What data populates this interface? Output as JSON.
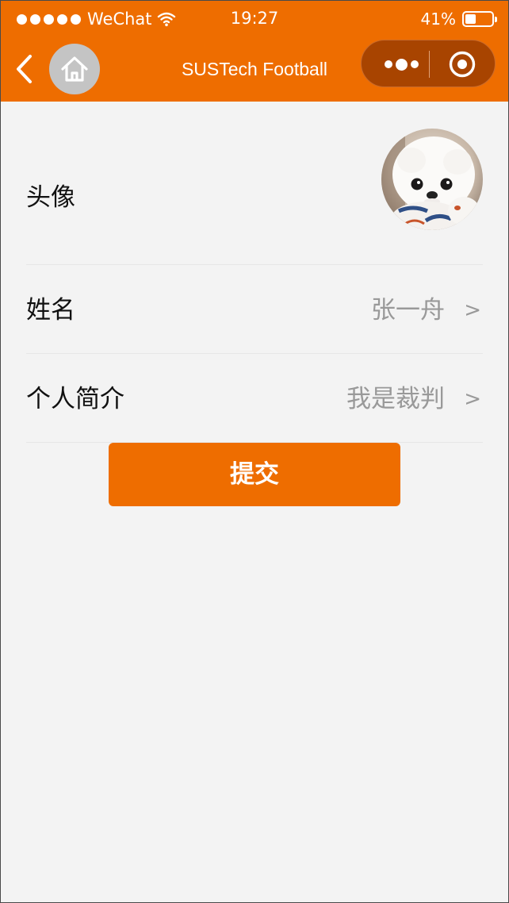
{
  "status_bar": {
    "carrier": "WeChat",
    "time": "19:27",
    "battery_text": "41%",
    "battery_level": 0.41
  },
  "nav": {
    "title": "SUSTech Football"
  },
  "form": {
    "avatar_label": "头像",
    "name_label": "姓名",
    "name_value": "张一舟",
    "intro_label": "个人简介",
    "intro_value": "我是裁判",
    "arrow": ">"
  },
  "submit_label": "提交",
  "colors": {
    "brand": "#ee6d00",
    "capsule": "#a84400",
    "background": "#f3f3f3",
    "value_text": "#999999"
  }
}
